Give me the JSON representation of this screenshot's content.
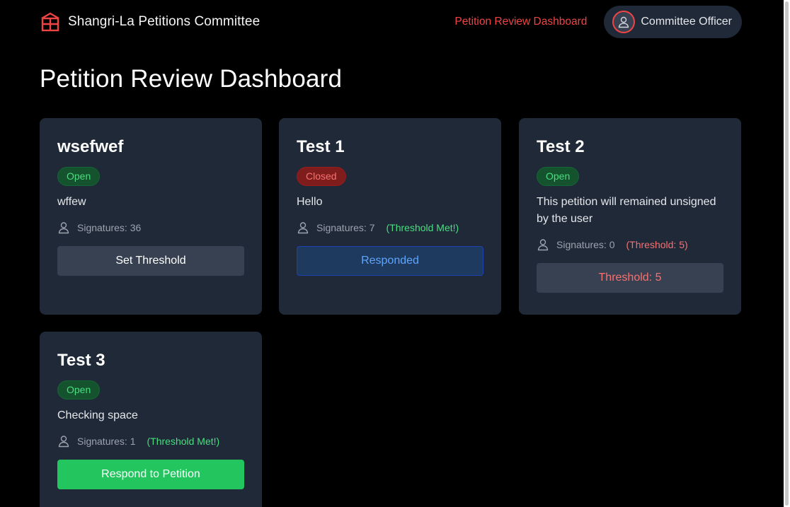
{
  "header": {
    "brand": "Shangri-La Petitions Committee",
    "nav_link": "Petition Review Dashboard",
    "user": "Committee Officer"
  },
  "page_title": "Petition Review Dashboard",
  "colors": {
    "accent": "#ef4444",
    "card_bg": "#1f2937",
    "open_green": "#4ade80",
    "closed_red": "#f87171",
    "respond_green": "#22c55e",
    "responded_blue": "#60a5fa"
  },
  "icons": {
    "brand": "building-icon",
    "user": "user-icon",
    "signatures": "person-icon"
  },
  "petitions": [
    {
      "title": "wsefwef",
      "status": "Open",
      "description": "wffew",
      "signatures": "Signatures: 36",
      "note": "",
      "button": "Set Threshold"
    },
    {
      "title": "Test 1",
      "status": "Closed",
      "description": "Hello",
      "signatures": "Signatures: 7",
      "note": "(Threshold Met!)",
      "button": "Responded"
    },
    {
      "title": "Test 2",
      "status": "Open",
      "description": "This petition will remained unsigned by the user",
      "signatures": "Signatures: 0",
      "note": "(Threshold: 5)",
      "button": "Threshold: 5"
    },
    {
      "title": "Test 3",
      "status": "Open",
      "description": "Checking space",
      "signatures": "Signatures: 1",
      "note": "(Threshold Met!)",
      "button": "Respond to Petition"
    }
  ]
}
